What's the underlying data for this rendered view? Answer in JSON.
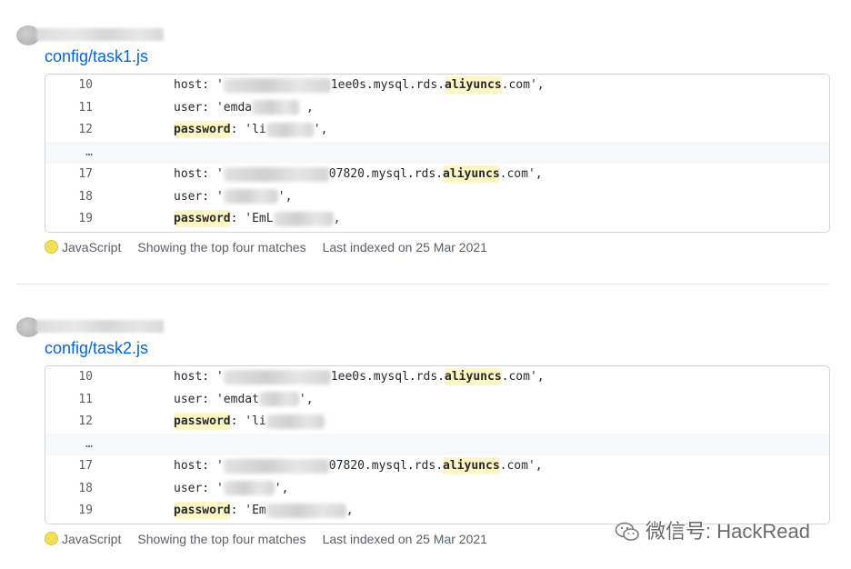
{
  "results": [
    {
      "file_name": "config/task1.js",
      "lines": [
        {
          "num": "10",
          "pre": "host: '",
          "blur_w": 118,
          "post": "1ee0s.mysql.rds.",
          "kw": "aliyuncs",
          "tail": ".com',"
        },
        {
          "num": "11",
          "pre": "user: 'emda",
          "blur_w": 52,
          "post": " ,",
          "kw": "",
          "tail": ""
        },
        {
          "num": "12",
          "pre": "",
          "kw_first": "password",
          "mid": ": 'li",
          "blur_w": 52,
          "post": "',",
          "kw": "",
          "tail": ""
        },
        {
          "num": "…",
          "sep": true
        },
        {
          "num": "17",
          "pre": "host: '",
          "blur_w": 116,
          "post": "07820.mysql.rds.",
          "kw": "aliyuncs",
          "tail": ".com',"
        },
        {
          "num": "18",
          "pre": "user: '",
          "blur_w": 60,
          "post": "',",
          "kw": "",
          "tail": ""
        },
        {
          "num": "19",
          "pre": "",
          "kw_first": "password",
          "mid": ": 'EmL",
          "blur_w": 66,
          "post": ",",
          "kw": "",
          "tail": ""
        }
      ],
      "language": "JavaScript",
      "matches_text": "Showing the top four matches",
      "indexed_text": "Last indexed on 25 Mar 2021"
    },
    {
      "file_name": "config/task2.js",
      "lines": [
        {
          "num": "10",
          "pre": "host: '",
          "blur_w": 118,
          "post": "1ee0s.mysql.rds.",
          "kw": "aliyuncs",
          "tail": ".com',"
        },
        {
          "num": "11",
          "pre": "user: 'emdat",
          "blur_w": 44,
          "post": "',",
          "kw": "",
          "tail": ""
        },
        {
          "num": "12",
          "pre": "",
          "kw_first": "password",
          "mid": ": 'li",
          "blur_w": 64,
          "post": "",
          "kw": "",
          "tail": ""
        },
        {
          "num": "…",
          "sep": true
        },
        {
          "num": "17",
          "pre": "host: '",
          "blur_w": 116,
          "post": "07820.mysql.rds.",
          "kw": "aliyuncs",
          "tail": ".com',"
        },
        {
          "num": "18",
          "pre": "user: '",
          "blur_w": 56,
          "post": "',",
          "kw": "",
          "tail": ""
        },
        {
          "num": "19",
          "pre": "",
          "kw_first": "password",
          "mid": ": 'Em",
          "blur_w": 88,
          "post": ",",
          "kw": "",
          "tail": ""
        }
      ],
      "language": "JavaScript",
      "matches_text": "Showing the top four matches",
      "indexed_text": "Last indexed on 25 Mar 2021"
    }
  ],
  "watermark": "微信号: HackRead",
  "colors": {
    "link": "#0366d6",
    "highlight": "#fff6c5",
    "javascript_dot": "#f1e05a"
  }
}
